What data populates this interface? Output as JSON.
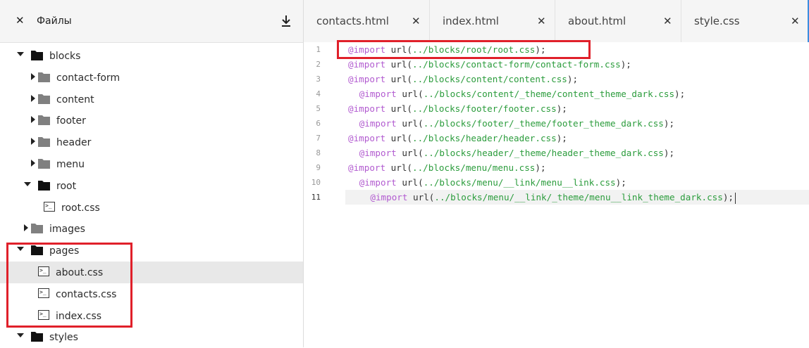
{
  "sidebar": {
    "title": "Файлы",
    "close_glyph": "✕",
    "download_icon": "download-icon",
    "tree": [
      {
        "label": "blocks",
        "type": "folder",
        "state": "open",
        "color": "#111111"
      },
      {
        "label": "contact-form",
        "type": "folder",
        "state": "closed",
        "color": "#808080"
      },
      {
        "label": "content",
        "type": "folder",
        "state": "closed",
        "color": "#808080"
      },
      {
        "label": "footer",
        "type": "folder",
        "state": "closed",
        "color": "#808080"
      },
      {
        "label": "header",
        "type": "folder",
        "state": "closed",
        "color": "#808080"
      },
      {
        "label": "menu",
        "type": "folder",
        "state": "closed",
        "color": "#808080"
      },
      {
        "label": "root",
        "type": "folder",
        "state": "open",
        "color": "#111111"
      },
      {
        "label": "root.css",
        "type": "file"
      },
      {
        "label": "images",
        "type": "folder",
        "state": "closed",
        "color": "#808080"
      },
      {
        "label": "pages",
        "type": "folder",
        "state": "open",
        "color": "#111111"
      },
      {
        "label": "about.css",
        "type": "file",
        "selected": true
      },
      {
        "label": "contacts.css",
        "type": "file"
      },
      {
        "label": "index.css",
        "type": "file"
      },
      {
        "label": "styles",
        "type": "folder",
        "state": "open",
        "color": "#111111"
      }
    ]
  },
  "tabs": [
    {
      "label": "contacts.html",
      "close": "✕"
    },
    {
      "label": "index.html",
      "close": "✕"
    },
    {
      "label": "about.html",
      "close": "✕"
    },
    {
      "label": "style.css",
      "close": "✕",
      "active": true
    }
  ],
  "editor": {
    "current_line": 11,
    "lines": [
      {
        "n": "1",
        "kw": "@import",
        "fn": " url(",
        "str": "../blocks/root/root.css",
        "end": ");"
      },
      {
        "n": "2",
        "kw": "@import",
        "fn": " url(",
        "str": "../blocks/contact-form/contact-form.css",
        "end": ");"
      },
      {
        "n": "3",
        "kw": "@import",
        "fn": " url(",
        "str": "../blocks/content/content.css",
        "end": ");"
      },
      {
        "n": "4",
        "kw": "@import",
        "fn": " url(",
        "str": "../blocks/content/_theme/content_theme_dark.css",
        "end": ");"
      },
      {
        "n": "5",
        "kw": "@import",
        "fn": " url(",
        "str": "../blocks/footer/footer.css",
        "end": ");"
      },
      {
        "n": "6",
        "kw": "@import",
        "fn": " url(",
        "str": "../blocks/footer/_theme/footer_theme_dark.css",
        "end": ");"
      },
      {
        "n": "7",
        "kw": "@import",
        "fn": " url(",
        "str": "../blocks/header/header.css",
        "end": ");"
      },
      {
        "n": "8",
        "kw": "@import",
        "fn": " url(",
        "str": "../blocks/header/_theme/header_theme_dark.css",
        "end": ");"
      },
      {
        "n": "9",
        "kw": "@import",
        "fn": " url(",
        "str": "../blocks/menu/menu.css",
        "end": ");"
      },
      {
        "n": "10",
        "kw": "@import",
        "fn": " url(",
        "str": "../blocks/menu/__link/menu__link.css",
        "end": ");"
      },
      {
        "n": "11",
        "kw": "@import",
        "fn": " url(",
        "str": "../blocks/menu/__link/_theme/menu__link_theme_dark.css",
        "end": ");"
      }
    ]
  },
  "colors": {
    "keyword": "#b25bd0",
    "string": "#2b9c3c",
    "highlight_box": "#e0202a",
    "active_tab_indicator": "#3b8de0"
  }
}
